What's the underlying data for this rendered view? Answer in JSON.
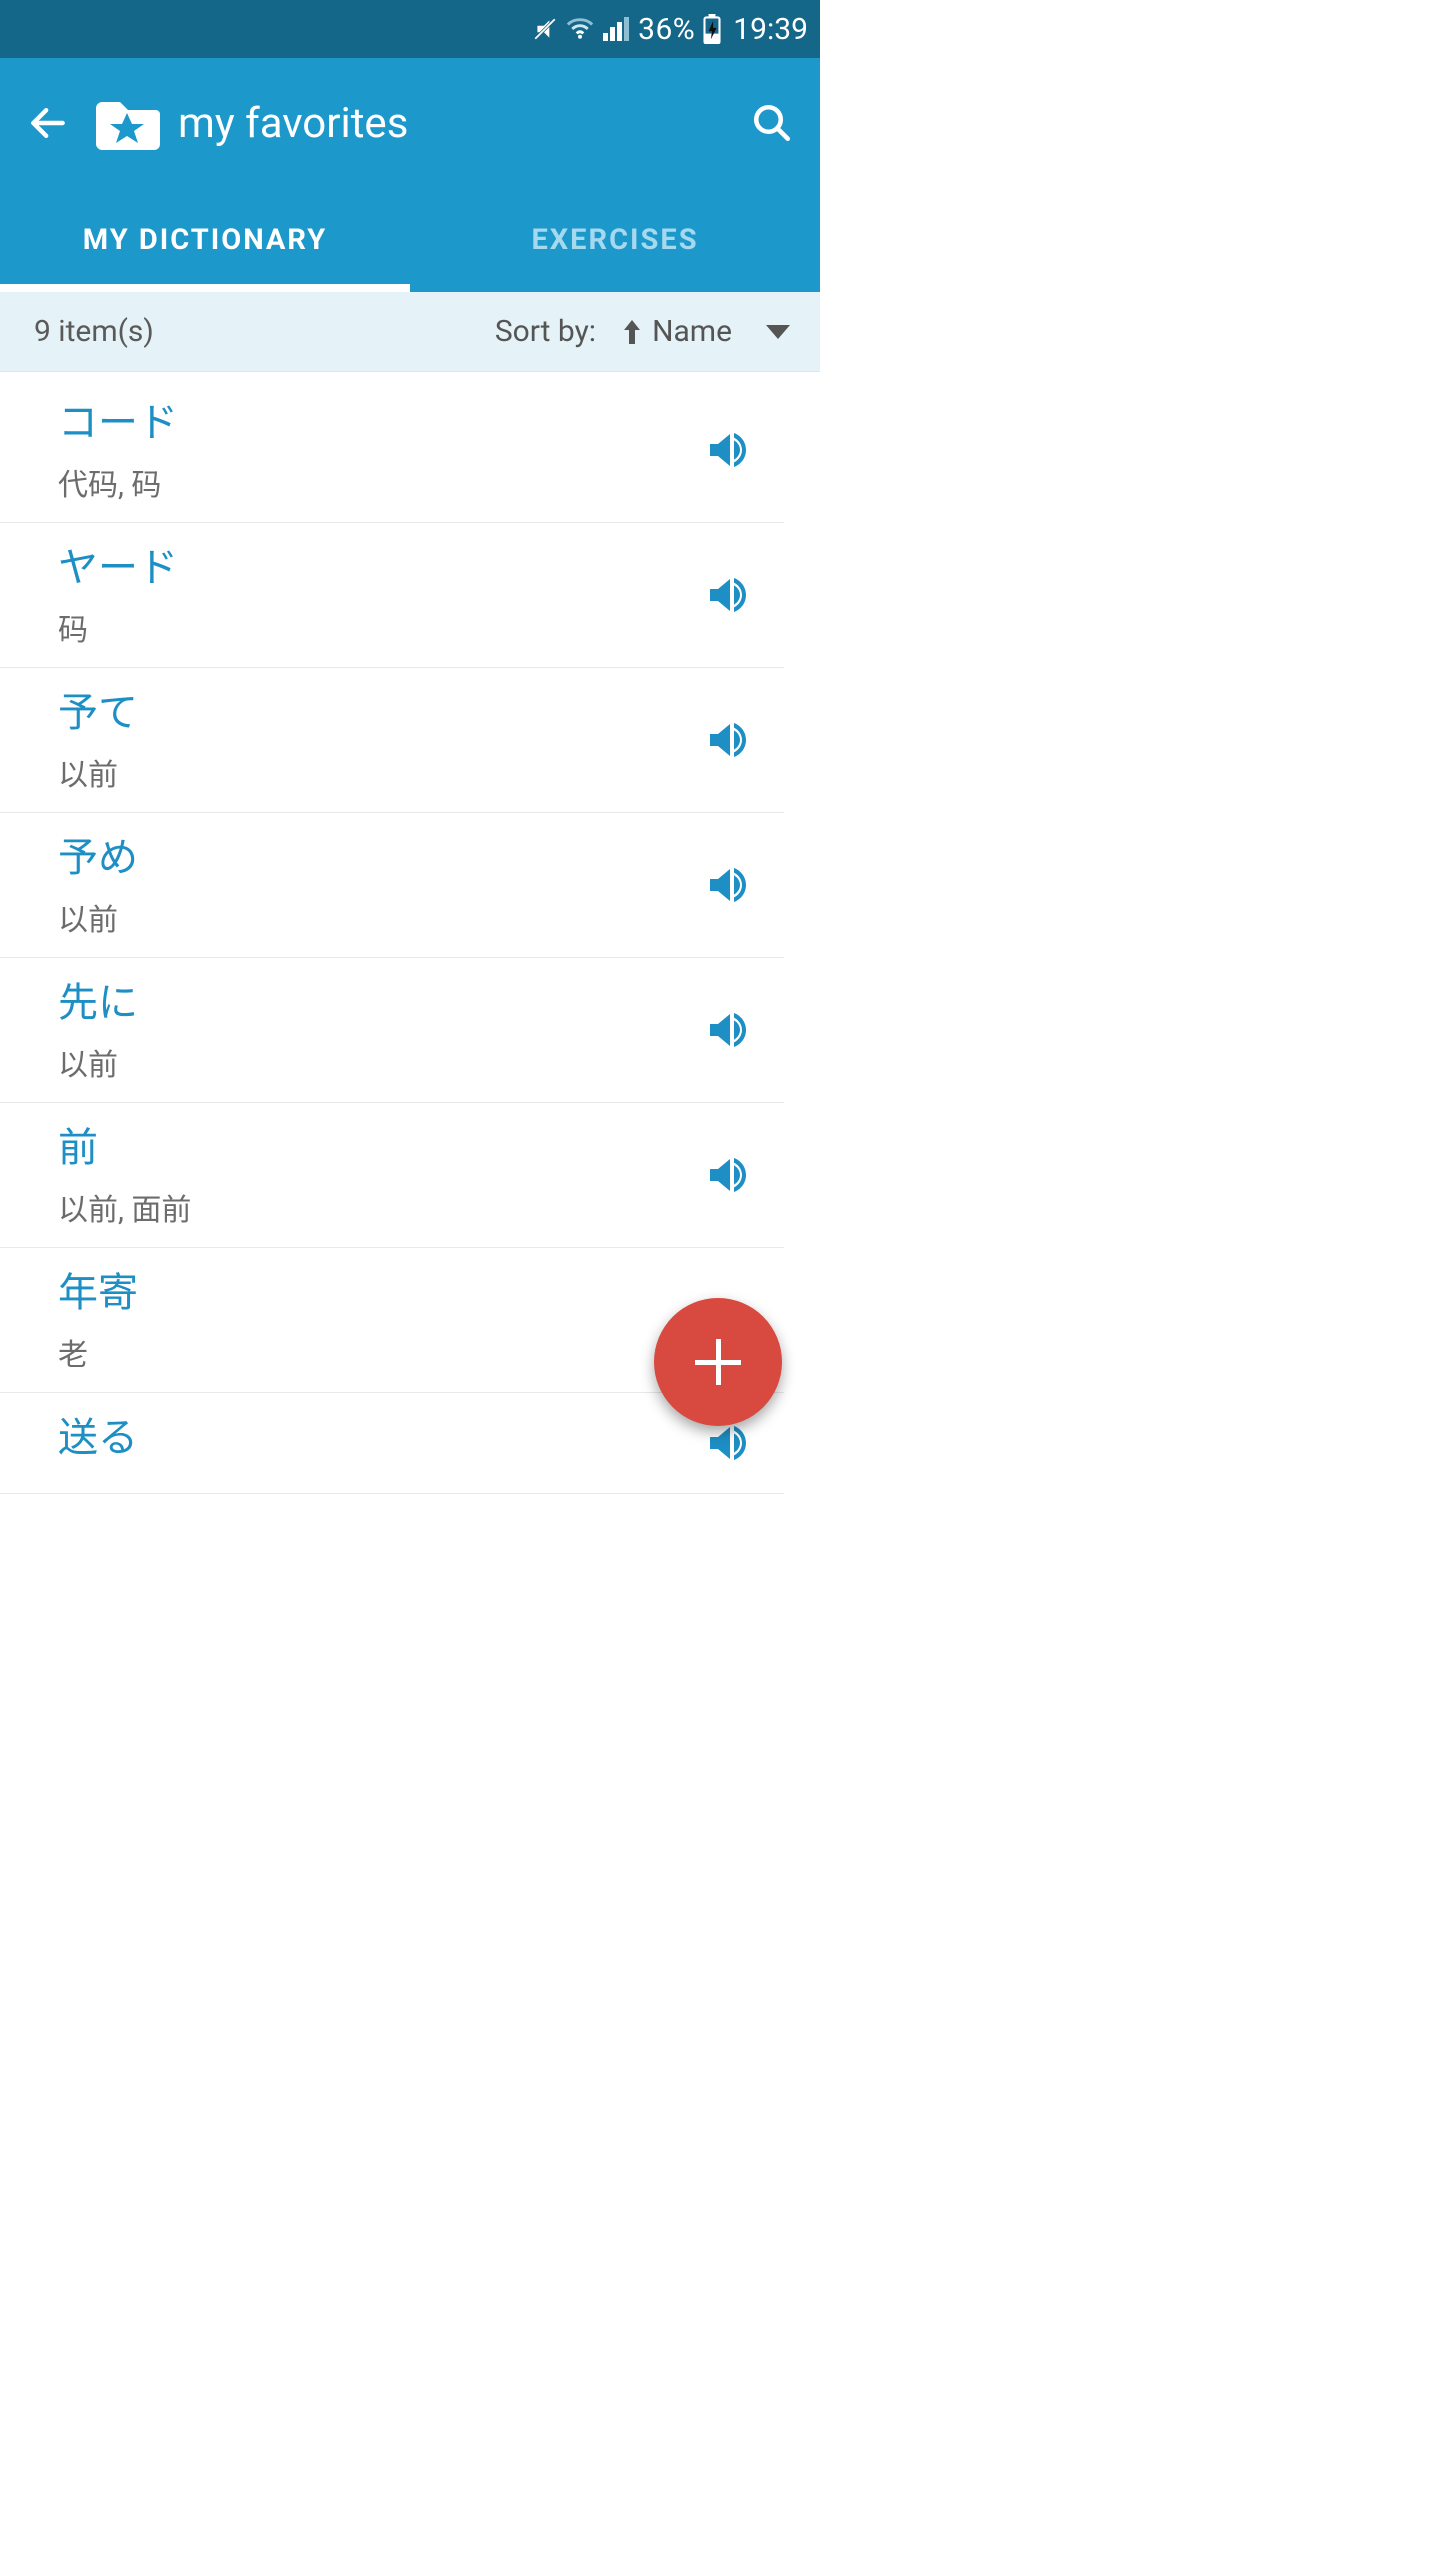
{
  "status": {
    "battery_pct": "36%",
    "time": "19:39"
  },
  "header": {
    "title": "my favorites"
  },
  "tabs": [
    {
      "label": "MY DICTIONARY",
      "active": true
    },
    {
      "label": "EXERCISES",
      "active": false
    }
  ],
  "sort": {
    "count_label": "9 item(s)",
    "sort_by_label": "Sort by:",
    "sort_key": "Name"
  },
  "items": [
    {
      "jp": "コード",
      "cn": "代码, 码"
    },
    {
      "jp": "ヤード",
      "cn": "码"
    },
    {
      "jp": "予て",
      "cn": "以前"
    },
    {
      "jp": "予め",
      "cn": "以前"
    },
    {
      "jp": "先に",
      "cn": "以前"
    },
    {
      "jp": "前",
      "cn": "以前, 面前"
    },
    {
      "jp": "年寄",
      "cn": "老"
    },
    {
      "jp": "送る",
      "cn": ""
    }
  ]
}
